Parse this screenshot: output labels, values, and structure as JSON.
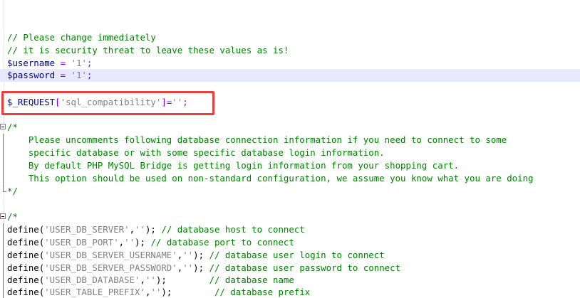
{
  "editor": {
    "lines": [
      {
        "segments": [
          {
            "type": "comment",
            "text": "// Please change immediately"
          }
        ]
      },
      {
        "segments": [
          {
            "type": "comment",
            "text": "// it is security threat to leave these values as is!"
          }
        ]
      },
      {
        "segments": [
          {
            "type": "var",
            "text": "$username"
          },
          {
            "type": "op",
            "text": " = "
          },
          {
            "type": "str",
            "text": "'1'"
          },
          {
            "type": "op",
            "text": ";"
          }
        ]
      },
      {
        "segments": [
          {
            "type": "var",
            "text": "$password"
          },
          {
            "type": "op",
            "text": " = "
          },
          {
            "type": "str",
            "text": "'1'"
          },
          {
            "type": "op",
            "text": ";"
          }
        ]
      },
      {
        "segments": [
          {
            "type": "var",
            "text": "$_REQUEST"
          },
          {
            "type": "op",
            "text": "["
          },
          {
            "type": "str",
            "text": "'sql_compatibility'"
          },
          {
            "type": "op",
            "text": "]="
          },
          {
            "type": "str",
            "text": "''"
          },
          {
            "type": "op",
            "text": ";"
          }
        ]
      },
      {
        "segments": [
          {
            "type": "comment",
            "text": "/*"
          }
        ]
      },
      {
        "segments": [
          {
            "type": "comment",
            "text": "    Please uncomments following database connection information if you need to connect to some"
          }
        ]
      },
      {
        "segments": [
          {
            "type": "comment",
            "text": "    specific database or with some specific database login information."
          }
        ]
      },
      {
        "segments": [
          {
            "type": "comment",
            "text": "    By default PHP MySQL Bridge is getting login information from your shopping cart."
          }
        ]
      },
      {
        "segments": [
          {
            "type": "comment",
            "text": "    This option should be used on non-standard configuration, we assume you know what you are doing"
          }
        ]
      },
      {
        "segments": [
          {
            "type": "comment",
            "text": "*/"
          }
        ]
      },
      {
        "segments": [
          {
            "type": "comment",
            "text": "/*"
          }
        ]
      },
      {
        "segments": [
          {
            "type": "plain",
            "text": "define("
          },
          {
            "type": "str",
            "text": "'USER_DB_SERVER'"
          },
          {
            "type": "plain",
            "text": ","
          },
          {
            "type": "str",
            "text": "''"
          },
          {
            "type": "plain",
            "text": "); "
          },
          {
            "type": "comment",
            "text": "// database host to connect"
          }
        ]
      },
      {
        "segments": [
          {
            "type": "plain",
            "text": "define("
          },
          {
            "type": "str",
            "text": "'USER_DB_PORT'"
          },
          {
            "type": "plain",
            "text": ","
          },
          {
            "type": "str",
            "text": "''"
          },
          {
            "type": "plain",
            "text": "); "
          },
          {
            "type": "comment",
            "text": "// database port to connect"
          }
        ]
      },
      {
        "segments": [
          {
            "type": "plain",
            "text": "define("
          },
          {
            "type": "str",
            "text": "'USER_DB_SERVER_USERNAME'"
          },
          {
            "type": "plain",
            "text": ","
          },
          {
            "type": "str",
            "text": "''"
          },
          {
            "type": "plain",
            "text": "); "
          },
          {
            "type": "comment",
            "text": "// database user login to connect"
          }
        ]
      },
      {
        "segments": [
          {
            "type": "plain",
            "text": "define("
          },
          {
            "type": "str",
            "text": "'USER_DB_SERVER_PASSWORD'"
          },
          {
            "type": "plain",
            "text": ","
          },
          {
            "type": "str",
            "text": "''"
          },
          {
            "type": "plain",
            "text": "); "
          },
          {
            "type": "comment",
            "text": "// database user password to connect"
          }
        ]
      },
      {
        "segments": [
          {
            "type": "plain",
            "text": "define("
          },
          {
            "type": "str",
            "text": "'USER_DB_DATABASE'"
          },
          {
            "type": "plain",
            "text": ","
          },
          {
            "type": "str",
            "text": "''"
          },
          {
            "type": "plain",
            "text": ");        "
          },
          {
            "type": "comment",
            "text": "// database name"
          }
        ]
      },
      {
        "segments": [
          {
            "type": "plain",
            "text": "define("
          },
          {
            "type": "str",
            "text": "'USER_TABLE_PREFIX'"
          },
          {
            "type": "plain",
            "text": ","
          },
          {
            "type": "str",
            "text": "''"
          },
          {
            "type": "plain",
            "text": ");        "
          },
          {
            "type": "comment",
            "text": "// database prefix"
          }
        ]
      }
    ]
  },
  "colors": {
    "comment": "#008000",
    "variable": "#000080",
    "operator": "#8000ff",
    "string": "#808080",
    "current_line": "#e8e8ff",
    "highlight_box": "#e8403f"
  },
  "icons": {
    "fold_open": "fold-minus-icon",
    "fold_end": "fold-end-icon"
  }
}
